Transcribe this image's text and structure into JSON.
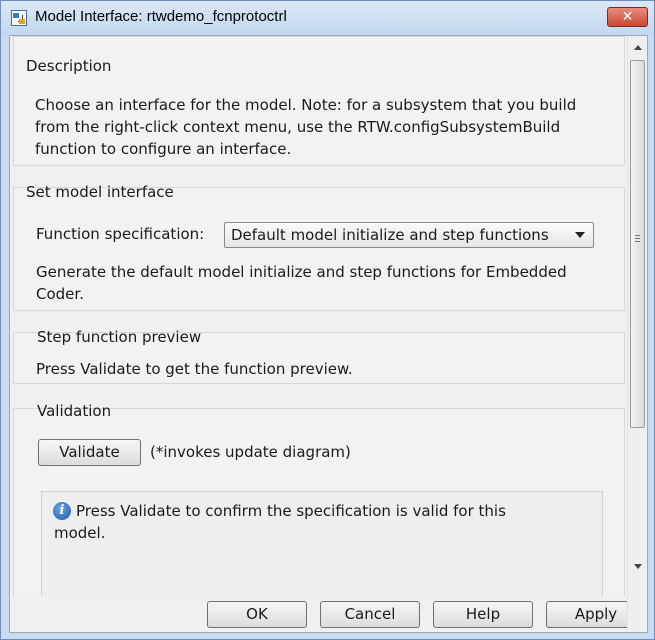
{
  "window": {
    "title": "Model Interface: rtwdemo_fcnprotoctrl",
    "close_label": "✕"
  },
  "description": {
    "heading": "Description",
    "text": "Choose an interface for the model. Note: for a subsystem that you build from the right-click context menu, use the RTW.configSubsystemBuild function to configure an interface."
  },
  "set_interface": {
    "heading": "Set model interface",
    "spec_label": "Function specification:",
    "spec_value": "Default model initialize and step functions",
    "spec_help": "Generate the default model initialize and step functions for Embedded Coder."
  },
  "preview": {
    "heading": "Step function preview",
    "text": "Press Validate to get the function preview."
  },
  "validation": {
    "heading": "Validation",
    "button_label": "Validate",
    "note": "(*invokes update diagram)",
    "message": "Press Validate to confirm the specification is valid for this model."
  },
  "buttons": {
    "ok": "OK",
    "cancel": "Cancel",
    "help": "Help",
    "apply": "Apply"
  },
  "icons": {
    "app": "model-icon",
    "info": "info-icon",
    "close": "close-icon"
  }
}
